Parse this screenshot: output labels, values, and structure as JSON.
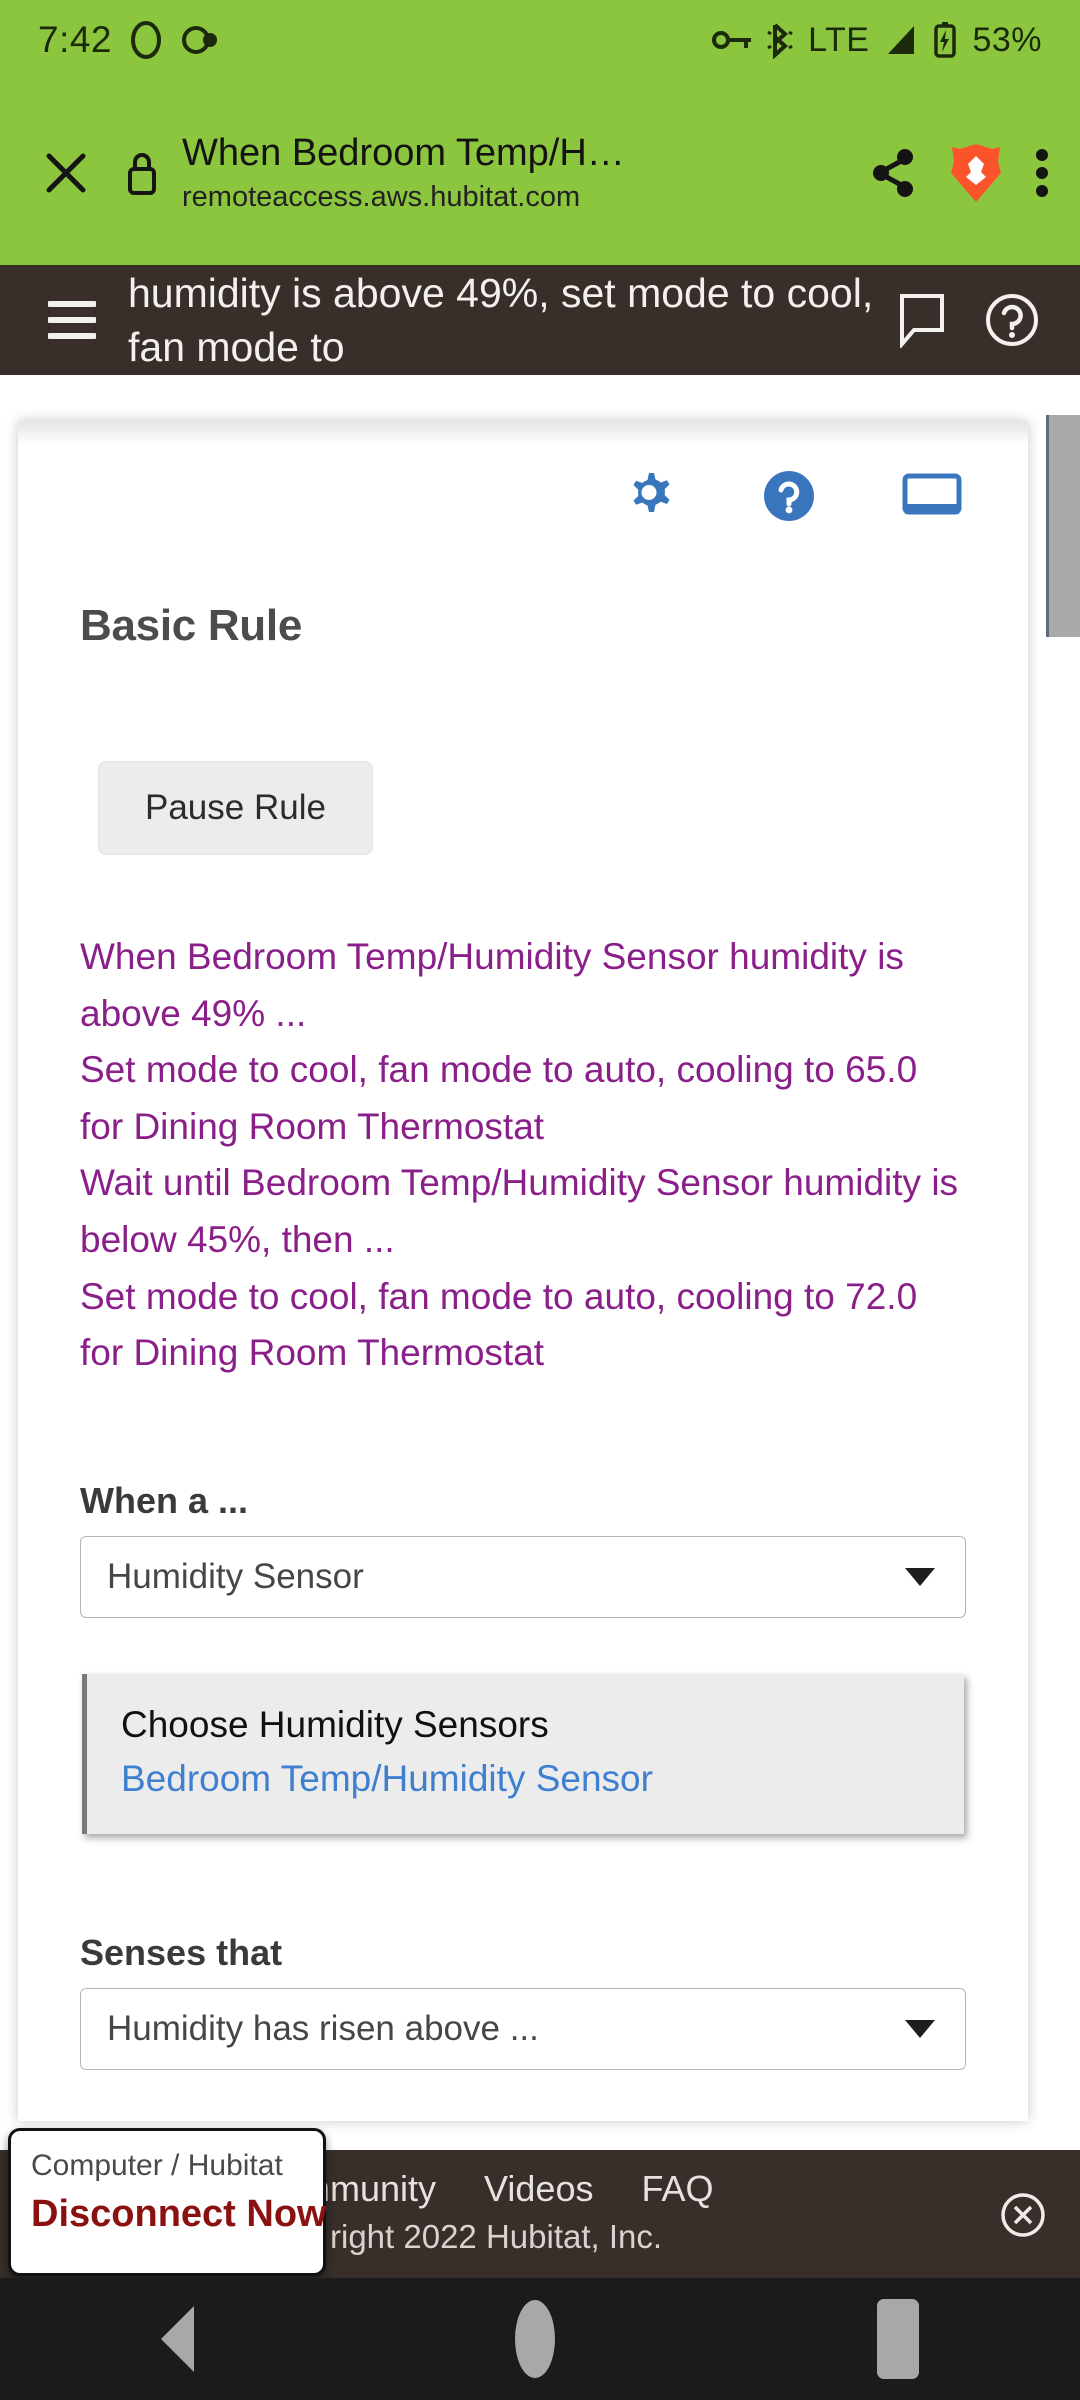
{
  "status_bar": {
    "time": "7:42",
    "icons_left": [
      "circle-outline-icon",
      "eye-slash-icon"
    ],
    "icons_right": [
      "key-icon",
      "bluetooth-icon"
    ],
    "network_label": "LTE",
    "signal_icon": "signal-bars-icon",
    "battery_icon": "battery-charging-icon",
    "battery_label": "53%"
  },
  "browser_bar": {
    "close_icon": "close-icon",
    "lock_icon": "lock-icon",
    "page_title": "When Bedroom Temp/H…",
    "url": "remoteaccess.aws.hubitat.com",
    "share_icon": "share-icon",
    "brave_icon": "brave-lion-icon",
    "overflow_icon": "more-vertical-icon"
  },
  "app_bar": {
    "menu_icon": "hamburger-menu-icon",
    "title": "humidity is above 49%, set mode to cool, fan mode to",
    "feedback_icon": "chat-bubble-icon",
    "help_icon": "help-circle-icon"
  },
  "card": {
    "icons": [
      {
        "name": "gear-icon"
      },
      {
        "name": "help-circle-icon"
      },
      {
        "name": "display-icon"
      }
    ],
    "heading": "Basic Rule",
    "pause_button": "Pause Rule",
    "rule_description": [
      "When Bedroom Temp/Humidity Sensor humidity is above 49% ...",
      "Set mode to cool, fan mode to auto, cooling to 65.0 for Dining Room Thermostat",
      "Wait until Bedroom Temp/Humidity Sensor humidity is below 45%, then ...",
      "Set mode to cool, fan mode to auto, cooling to 72.0 for Dining Room Thermostat"
    ],
    "when_a_label": "When a ...",
    "when_a_value": "Humidity Sensor",
    "chooser_title": "Choose Humidity Sensors",
    "chooser_value": "Bedroom Temp/Humidity Sensor",
    "senses_label": "Senses that",
    "senses_value": "Humidity has risen above ..."
  },
  "footer": {
    "links": [
      "Community",
      "Videos",
      "FAQ"
    ],
    "copyright": "right 2022 Hubitat, Inc.",
    "close_icon": "close-circle-icon"
  },
  "disconnect_popup": {
    "label": "Computer / Hubitat",
    "action": "Disconnect Now"
  },
  "nav_bar": {
    "back": "back-icon",
    "home": "home-icon",
    "recents": "recents-icon"
  },
  "colors": {
    "status_green": "#8cc63e",
    "app_dark": "#382f2b",
    "accent_blue": "#3a76bd",
    "rule_purple": "#8a1f8a",
    "link_blue": "#3f7fd0",
    "disconnect_red": "#8b1111"
  }
}
